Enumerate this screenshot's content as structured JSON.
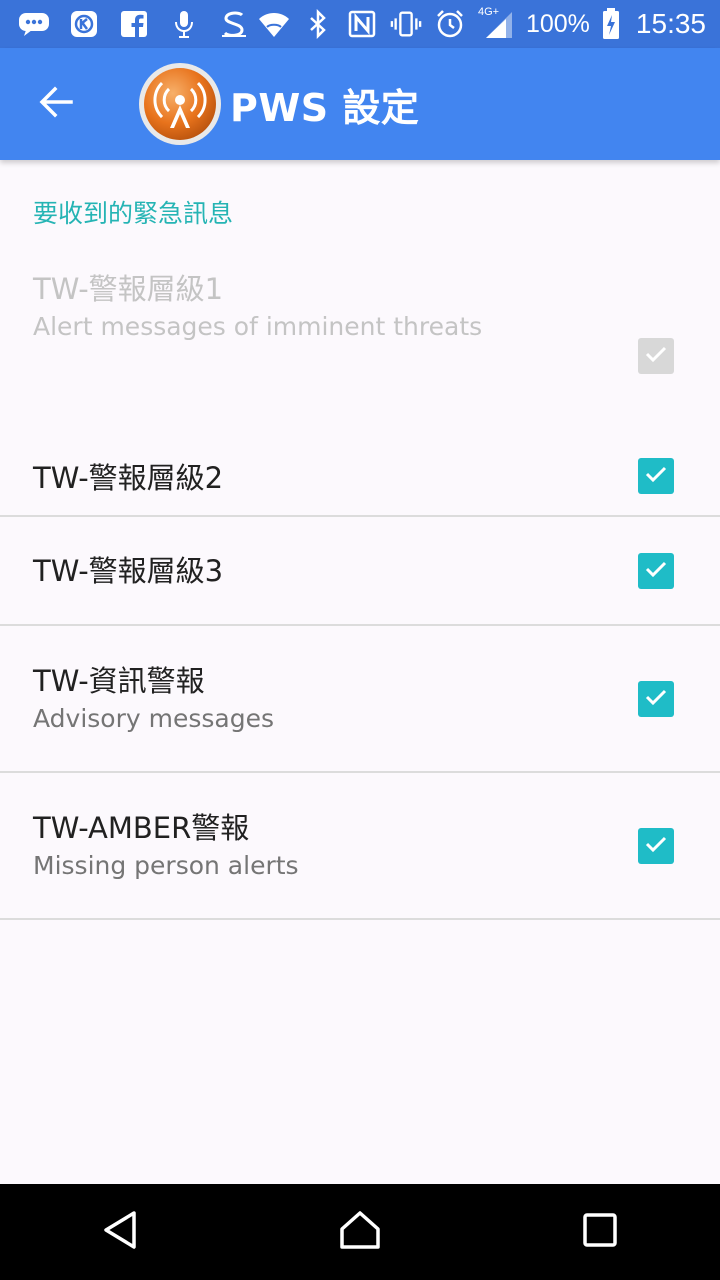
{
  "status_bar": {
    "battery": "100%",
    "time": "15:35",
    "network_label": "4G+",
    "icons": [
      "chat-icon",
      "k-app-icon",
      "facebook-icon",
      "microphone-icon",
      "s-app-icon",
      "wifi-icon",
      "bluetooth-icon",
      "nfc-icon",
      "vibrate-icon",
      "alarm-icon",
      "signal-icon",
      "battery-icon"
    ]
  },
  "app_bar": {
    "title": "PWS 設定",
    "back_icon": "arrow-left-icon",
    "logo_icon": "broadcast-icon",
    "colors": {
      "bar": "#4285f0",
      "status": "#3a73d9"
    }
  },
  "section": {
    "header": "要收到的緊急訊息",
    "accent": "#25b4b4"
  },
  "items": [
    {
      "title": "TW-警報層級1",
      "summary": "Alert messages of imminent threats",
      "checked": true,
      "enabled": false
    },
    {
      "title": "TW-警報層級2",
      "summary": "",
      "checked": true,
      "enabled": true
    },
    {
      "title": "TW-警報層級3",
      "summary": "",
      "checked": true,
      "enabled": true
    },
    {
      "title": "TW-資訊警報",
      "summary": "Advisory messages",
      "checked": true,
      "enabled": true
    },
    {
      "title": "TW-AMBER警報",
      "summary": "Missing person alerts",
      "checked": true,
      "enabled": true
    }
  ],
  "nav_bar": {
    "buttons": [
      "back-triangle-icon",
      "home-icon",
      "recents-square-icon"
    ]
  }
}
